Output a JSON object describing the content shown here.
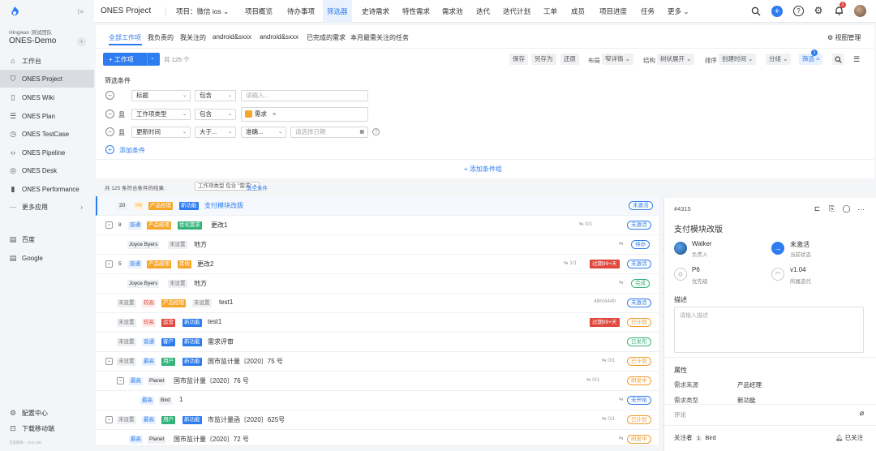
{
  "sidebar": {
    "org": "Hingwan 测试团队",
    "team": "ONES-Demo",
    "items": [
      {
        "label": "工作台"
      },
      {
        "label": "ONES Project"
      },
      {
        "label": "ONES Wiki"
      },
      {
        "label": "ONES Plan"
      },
      {
        "label": "ONES TestCase"
      },
      {
        "label": "ONES Pipeline"
      },
      {
        "label": "ONES Desk"
      },
      {
        "label": "ONES Performance"
      },
      {
        "label": "更多应用"
      }
    ],
    "links": [
      "百度",
      "Google"
    ],
    "settings": "配置中心",
    "download": "下载移动端",
    "version": "当前版本：v3.0.138"
  },
  "topbar": {
    "app": "ONES Project",
    "project": "项目：微信 ios",
    "tabs": [
      "项目概览",
      "待办事项",
      "筛选器",
      "史诗需求",
      "特性需求",
      "需求池",
      "迭代",
      "迭代计划",
      "工单",
      "成员",
      "项目进度",
      "任务",
      "更多"
    ],
    "active_tab": "筛选器",
    "notif_count": "1"
  },
  "views": {
    "tabs": [
      "全部工作项",
      "我负责的",
      "我关注的",
      "android&sxxx",
      "android&sxxx",
      "已完成的需求",
      "本月最需关注的任务"
    ],
    "manage": "视图管理"
  },
  "toolbar": {
    "new": "+ 工作项",
    "count": "共 125 个",
    "save": "保存",
    "save_as": "另存为",
    "restore": "还原",
    "layout_label": "布局",
    "layout": "窄详情",
    "struct_label": "结构",
    "struct": "树状展开",
    "sort_label": "排序",
    "sort": "创建时间",
    "group": "分组",
    "filter": "筛选",
    "filter_count": "1"
  },
  "filter": {
    "title": "筛选条件",
    "and": "且",
    "rows": [
      {
        "field": "标题",
        "op": "包含",
        "placeholder": "请输入..."
      },
      {
        "field": "工作项类型",
        "op": "包含",
        "value": "需求"
      },
      {
        "field": "更新时间",
        "op": "大于...",
        "value": "准确...",
        "date_placeholder": "请选择日期"
      }
    ],
    "add_cond": "添加条件",
    "add_group": "+ 添加条件组",
    "result": "共 125 条符合条件的结果:",
    "result_tag": "工作项类型 包含 \"需求\"",
    "clear": "清空条件"
  },
  "list": [
    {
      "num": "20",
      "priority": "P6",
      "tags": [
        "产品经理",
        "新功能"
      ],
      "title": "支付模块改版",
      "status": "未激活"
    },
    {
      "num": "8",
      "priority": "普通",
      "tags": [
        "产品经理",
        "优化需求"
      ],
      "title": "更改1",
      "sub": "0/1",
      "status": "未激活"
    },
    {
      "user": "Joyce Byers",
      "unset": "未设置",
      "title": "地方",
      "status": "待办"
    },
    {
      "num": "5",
      "priority": "普通",
      "tags": [
        "产品经理",
        "其他"
      ],
      "title": "更改2",
      "sub": "1/1",
      "overdue": "过期99+天",
      "status": "未激活"
    },
    {
      "user": "Joyce Byers",
      "unset": "未设置",
      "title": "地方",
      "status": "完成"
    },
    {
      "unset": "未设置",
      "priority": "较高",
      "tags": [
        "产品经理",
        "未设置"
      ],
      "title": "test1",
      "hours": "46h/444h",
      "status": "未激活"
    },
    {
      "unset": "未设置",
      "priority": "较高",
      "tags": [
        "运营",
        "新功能"
      ],
      "title": "test1",
      "overdue": "过期99+天",
      "status": "已计划"
    },
    {
      "unset": "未设置",
      "priority": "普通",
      "tags": [
        "客户",
        "新功能"
      ],
      "title": "需求评审",
      "status": "已发布"
    },
    {
      "unset": "未设置",
      "priority": "最高",
      "tags": [
        "用户",
        "新功能"
      ],
      "title": "国市监计量〔2020〕75 号",
      "sub": "0/1",
      "status": "已计划"
    },
    {
      "priority": "最高",
      "user": "Planet",
      "title": "国市监计量〔2020〕76 号",
      "sub": "0/1",
      "status": "研发中"
    },
    {
      "priority": "最高",
      "user": "Bird",
      "title": "1",
      "status": "未开始"
    },
    {
      "unset": "未设置",
      "priority": "最高",
      "tags": [
        "用户",
        "新功能"
      ],
      "title": "市监计量函〔2020〕625号",
      "sub": "0/1",
      "status": "已计划"
    },
    {
      "priority": "最高",
      "user": "Planet",
      "title": "国市监计量〔2020〕72 号",
      "status": "研发中"
    }
  ],
  "detail": {
    "id": "#4315",
    "title": "支付模块改版",
    "owner": "Walker",
    "owner_label": "负责人",
    "state": "未激活",
    "state_label": "当前状态",
    "priority": "P6",
    "priority_label": "优先级",
    "iteration": "v1.04",
    "iteration_label": "所属迭代",
    "desc_title": "描述",
    "desc_placeholder": "请输入描述",
    "props_title": "属性",
    "props": [
      {
        "k": "需求来源",
        "v": "产品经理"
      },
      {
        "k": "需求类型",
        "v": "新功能"
      }
    ],
    "comment": "评论",
    "followers_label": "关注者",
    "followers_count": "1",
    "follower": "Bird",
    "followed": "已关注"
  }
}
